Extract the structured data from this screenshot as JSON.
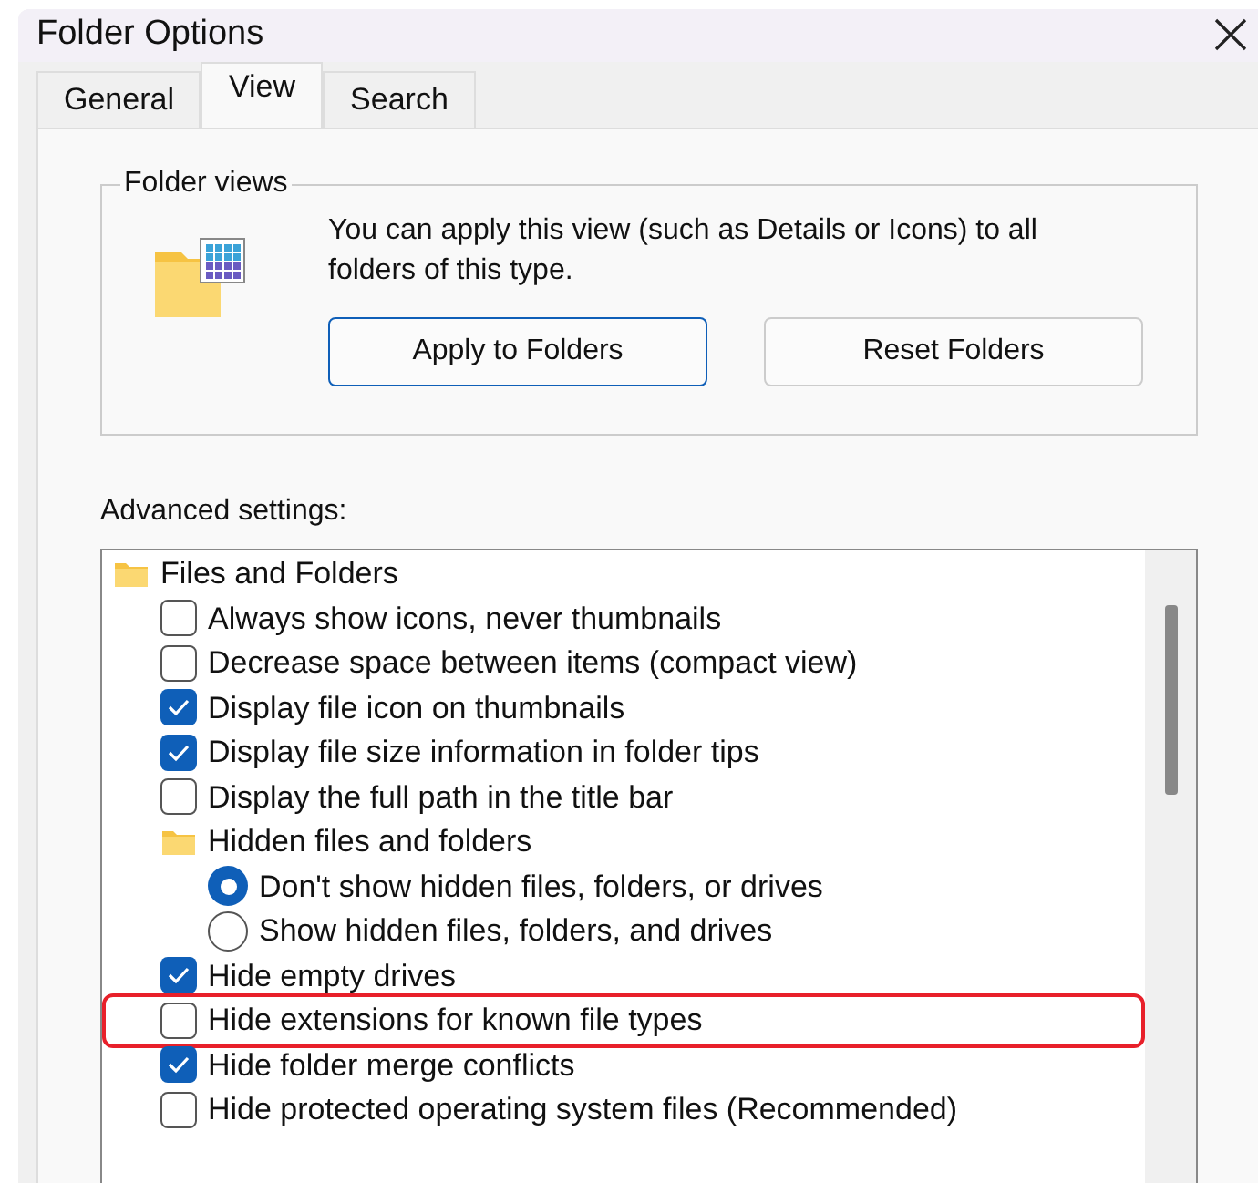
{
  "window": {
    "title": "Folder Options"
  },
  "tabs": [
    {
      "label": "General",
      "selected": false
    },
    {
      "label": "View",
      "selected": true
    },
    {
      "label": "Search",
      "selected": false
    }
  ],
  "folder_views": {
    "legend": "Folder views",
    "description": "You can apply this view (such as Details or Icons) to all folders of this type.",
    "buttons": [
      {
        "label": "Apply to Folders",
        "focused": true
      },
      {
        "label": "Reset Folders",
        "focused": false
      }
    ]
  },
  "advanced_settings": {
    "label": "Advanced settings:",
    "items": [
      {
        "kind": "folder",
        "label": "Files and Folders",
        "highlighted": false,
        "children": [
          {
            "kind": "checkbox",
            "label": "Always show icons, never thumbnails",
            "checked": false,
            "highlighted": false
          },
          {
            "kind": "checkbox",
            "label": "Decrease space between items (compact view)",
            "checked": false,
            "highlighted": false
          },
          {
            "kind": "checkbox",
            "label": "Display file icon on thumbnails",
            "checked": true,
            "highlighted": false
          },
          {
            "kind": "checkbox",
            "label": "Display file size information in folder tips",
            "checked": true,
            "highlighted": false
          },
          {
            "kind": "checkbox",
            "label": "Display the full path in the title bar",
            "checked": false,
            "highlighted": false
          },
          {
            "kind": "folder",
            "label": "Hidden files and folders",
            "highlighted": false,
            "children": [
              {
                "kind": "radio",
                "label": "Don't show hidden files, folders, or drives",
                "selected": true,
                "highlighted": false
              },
              {
                "kind": "radio",
                "label": "Show hidden files, folders, and drives",
                "selected": false,
                "highlighted": false
              }
            ]
          },
          {
            "kind": "checkbox",
            "label": "Hide empty drives",
            "checked": true,
            "highlighted": false
          },
          {
            "kind": "checkbox",
            "label": "Hide extensions for known file types",
            "checked": false,
            "highlighted": true
          },
          {
            "kind": "checkbox",
            "label": "Hide folder merge conflicts",
            "checked": true,
            "highlighted": false
          },
          {
            "kind": "checkbox",
            "label": "Hide protected operating system files (Recommended)",
            "checked": false,
            "highlighted": false
          }
        ]
      }
    ]
  }
}
